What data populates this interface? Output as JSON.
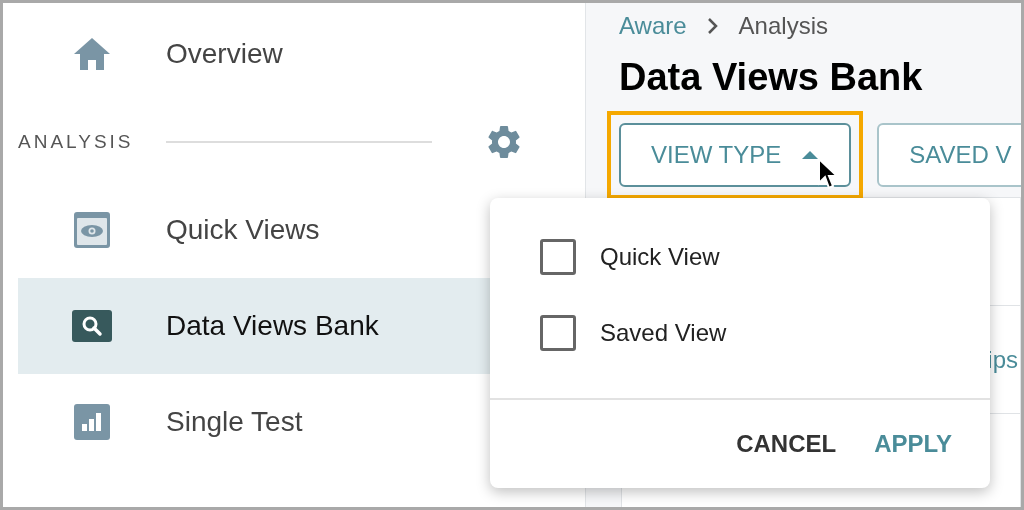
{
  "sidebar": {
    "items": [
      {
        "label": "Overview",
        "kind": "home",
        "selected": false
      }
    ],
    "section": {
      "label": "ANALYSIS"
    },
    "section_items": [
      {
        "label": "Quick Views",
        "kind": "eye",
        "selected": false
      },
      {
        "label": "Data Views Bank",
        "kind": "search",
        "selected": true
      },
      {
        "label": "Single Test",
        "kind": "chart",
        "selected": false
      }
    ]
  },
  "breadcrumb": [
    {
      "label": "Aware",
      "kind": "link"
    },
    {
      "label": "Analysis",
      "kind": "current"
    }
  ],
  "title": "Data Views Bank",
  "filters": [
    {
      "label": "VIEW TYPE",
      "expanded": true,
      "highlighted": true
    },
    {
      "label": "SAVED V",
      "expanded": false,
      "highlighted": false
    }
  ],
  "card_text": "ips",
  "popup": {
    "options": [
      {
        "label": "Quick View",
        "checked": false
      },
      {
        "label": "Saved View",
        "checked": false
      }
    ],
    "actions": [
      {
        "label": "CANCEL",
        "kind": "secondary"
      },
      {
        "label": "APPLY",
        "kind": "primary"
      }
    ]
  }
}
